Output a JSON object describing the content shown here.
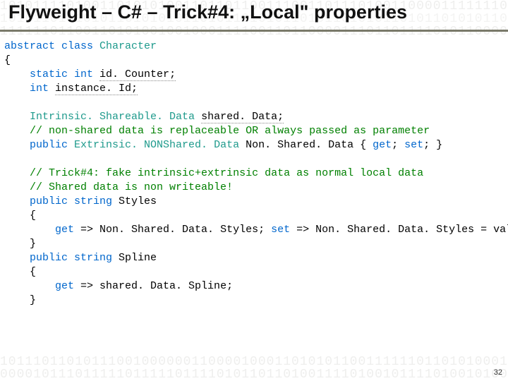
{
  "header": {
    "title": "Flyweight – C# – Trick#4: „Local\" properties"
  },
  "footer": {
    "page": "32"
  },
  "bg": {
    "r0": "1010111101001101010100110110110011100110111010011000011111110110010001001010",
    "r1": "1111110110011010100100100011110011011000011101101111010110000010101010101010",
    "rA": "1010110101010110101010110101101010110101101010110101101010110101101010110101",
    "b0": "0000101110111110111110111101011011010011110100101111010010100101010101001001",
    "b1": "1011101101011100100000011000010001101010110011111101101010001100110100010011"
  },
  "code": {
    "l0a": "abstract",
    "l0b": " class ",
    "l0c": "Character",
    "l1": "{",
    "l2a": "    ",
    "l2b": "static int ",
    "l2c": "id. Counter;",
    "l3a": "    ",
    "l3b": "int ",
    "l3c": "instance. Id;",
    "blank": "",
    "g": "    ",
    "l5a": "Intrinsic. Shareable. Data ",
    "l5b": "shared. Data;",
    "l6": "// non-shared data is replaceable OR always passed as parameter",
    "l7a": "public ",
    "l7b": "Extrinsic. NONShared. Data ",
    "l7c": "Non. Shared. Data { ",
    "l7d": "get",
    "l7e": "; ",
    "l7f": "set",
    "l7g": "; }",
    "l9": "// Trick#4: fake intrinsic+extrinsic data as normal local data",
    "l10": "// Shared data is non writeable!",
    "l11a": "public string ",
    "l11b": "Styles",
    "l12": "{",
    "l13a": "        ",
    "l13b": "get ",
    "l13c": "=> Non. Shared. Data. Styles; ",
    "l13d": "set ",
    "l13e": "=> Non. Shared. Data. Styles = valu",
    "l14": "}",
    "l15a": "public string ",
    "l15b": "Spline",
    "l16": "{",
    "l17a": "        ",
    "l17b": "get ",
    "l17c": "=> shared. Data. Spline;",
    "l18": "}"
  }
}
